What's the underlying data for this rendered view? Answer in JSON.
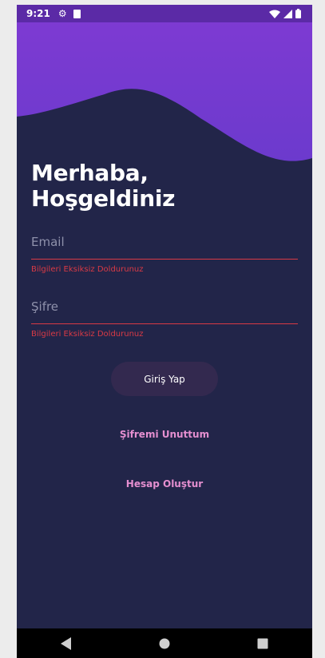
{
  "status_bar": {
    "time": "9:21",
    "icons": [
      "gear-icon",
      "sd-card-icon",
      "wifi-icon",
      "signal-icon",
      "battery-icon"
    ]
  },
  "colors": {
    "header_purple": "#7a3ad0",
    "background": "#222549",
    "accent_pink": "#e58fd0",
    "error_red": "#d93a45",
    "button_bg": "#33294f"
  },
  "greeting": {
    "line1": "Merhaba,",
    "line2": "Hoşgeldiniz"
  },
  "form": {
    "email": {
      "placeholder": "Email",
      "value": "",
      "error": "Bilgileri Eksiksiz Doldurunuz"
    },
    "password": {
      "placeholder": "Şifre",
      "value": "",
      "error": "Bilgileri Eksiksiz Doldurunuz"
    }
  },
  "actions": {
    "login_label": "Giriş Yap",
    "forgot_label": "Şifremi Unuttum",
    "register_label": "Hesap Oluştur"
  },
  "nav_bar": {
    "icons": [
      "back-icon",
      "home-icon",
      "recents-icon"
    ]
  }
}
